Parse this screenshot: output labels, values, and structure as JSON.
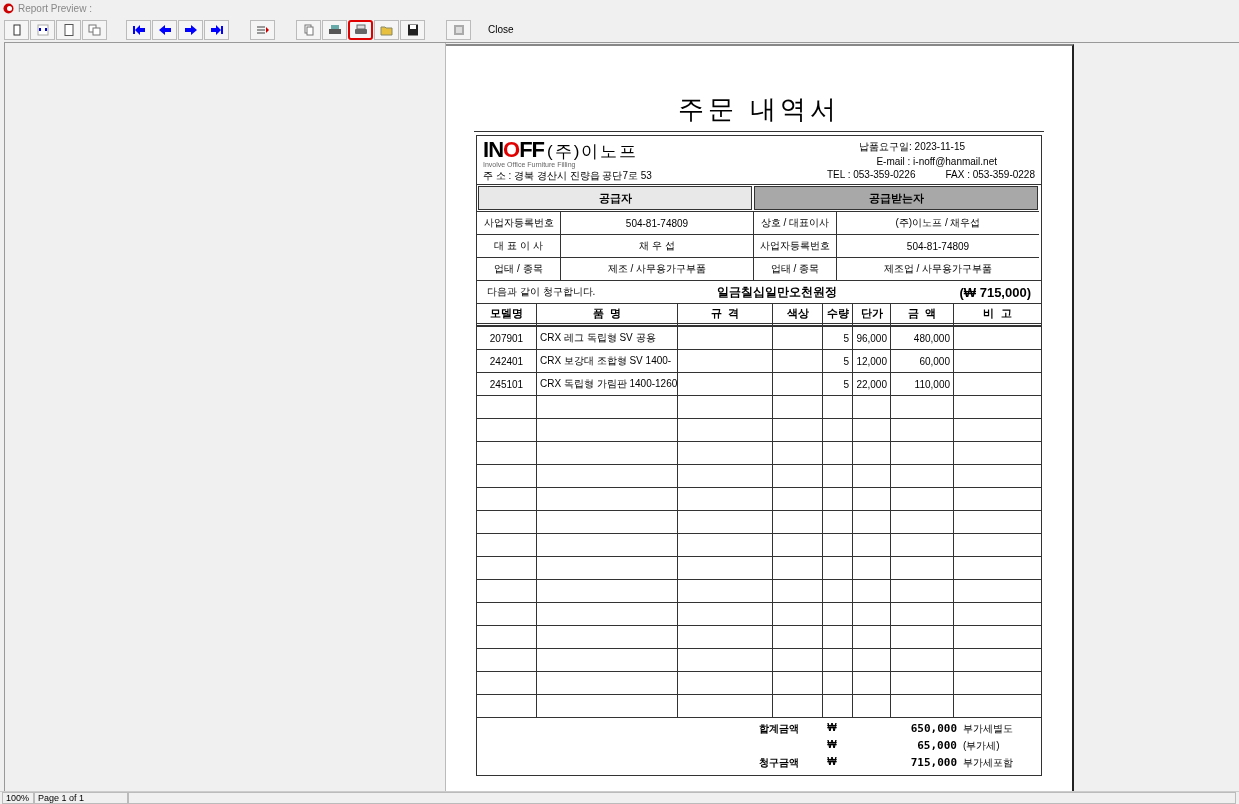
{
  "window": {
    "title": "Report Preview :"
  },
  "toolbar": {
    "buttons": [
      {
        "highlighted": false
      },
      {
        "highlighted": false
      },
      {
        "highlighted": false
      },
      {
        "highlighted": false
      },
      {
        "highlighted": false
      },
      {
        "highlighted": false
      },
      {
        "highlighted": false
      },
      {
        "highlighted": false
      },
      {
        "highlighted": false
      },
      {
        "highlighted": false
      },
      {
        "highlighted": false
      },
      {
        "highlighted": true
      },
      {
        "highlighted": false
      },
      {
        "highlighted": false
      },
      {
        "highlighted": false
      }
    ],
    "close_label": "Close"
  },
  "report": {
    "title": "주문 내역서",
    "logo": {
      "text": "INOFF",
      "company": "(주)이노프",
      "tagline": "Involve Office Furniture Filling"
    },
    "address": "주 소 : 경북 경산시 진량읍 공단7로 53",
    "due_date": "납품요구일: 2023-11-15",
    "email": "E-mail : i-noff@hanmail.net",
    "tel": "TEL : 053-359-0226",
    "fax": "FAX : 053-359-0228",
    "supplier_header": "공급자",
    "receiver_header": "공급받는자",
    "party_rows": [
      {
        "label_1": "사업자등록번호",
        "value_1": "504-81-74809",
        "label_2": "상호 / 대표이사",
        "value_2": "(주)이노프 / 채우섭"
      },
      {
        "label_1": "대 표 이 사",
        "value_1": "채 우 섭",
        "label_2": "사업자등록번호",
        "value_2": "504-81-74809"
      },
      {
        "label_1": "업태 / 종목",
        "value_1": "제조 / 사무용가구부품",
        "label_2": "업태 / 종목",
        "value_2": "제조업 / 사무용가구부품"
      }
    ],
    "claim_text": "다음과 같이 청구합니다.",
    "amount_words": "일금칠십일만오천원정",
    "amount_figure": "(₩ 715,000)",
    "columns": [
      "모델명",
      "품  명",
      "규  격",
      "색상",
      "수량",
      "단가",
      "금  액",
      "비  고"
    ],
    "rows": [
      [
        "207901",
        "CRX 레그 독립형 SV 공용",
        "",
        "",
        "5",
        "96,000",
        "480,000",
        ""
      ],
      [
        "242401",
        "CRX 보강대 조합형 SV 1400-",
        "",
        "",
        "5",
        "12,000",
        "60,000",
        ""
      ],
      [
        "245101",
        "CRX 독립형 가림판 1400-1260",
        "",
        "",
        "5",
        "22,000",
        "110,000",
        ""
      ]
    ],
    "totals": [
      {
        "label": "합계금액",
        "currency": "₩",
        "amount": "650,000",
        "note": "부가세별도"
      },
      {
        "currency": "₩",
        "amount": "65,000",
        "note": "(부가세)"
      },
      {
        "label": "청구금액",
        "currency": "₩",
        "amount": "715,000",
        "note": "부가세포함"
      }
    ]
  },
  "status_bar": {
    "zoom": "100%",
    "page": "Page 1 of 1"
  }
}
